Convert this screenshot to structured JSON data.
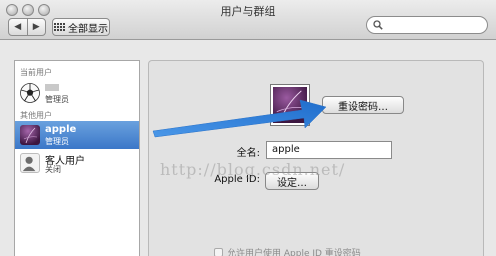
{
  "window": {
    "title": "用户与群组"
  },
  "toolbar": {
    "back_glyph": "◀",
    "forward_glyph": "▶",
    "show_all_label": "全部显示",
    "search": {
      "placeholder": "",
      "icon": "search-icon"
    }
  },
  "sidebar": {
    "current_users_label": "当前用户",
    "other_users_label": "其他用户",
    "current_user": {
      "name": "",
      "role": "管理员",
      "avatar": "soccer-ball"
    },
    "other_users": [
      {
        "name": "apple",
        "role": "管理员",
        "avatar": "purple-flower",
        "selected": true
      },
      {
        "name": "客人用户",
        "role": "关闭",
        "avatar": "guest-silhouette",
        "selected": false
      }
    ]
  },
  "main": {
    "reset_password_label": "重设密码…",
    "full_name_label": "全名:",
    "full_name_value": "apple",
    "apple_id_label": "Apple ID:",
    "setup_label": "设定…",
    "allow_reset_label": "允许用户使用 Apple ID 重设密码"
  },
  "watermark": "http://blog.csdn.net/",
  "colors": {
    "selection": "#3b77c8",
    "arrow": "#2f7fd6"
  }
}
